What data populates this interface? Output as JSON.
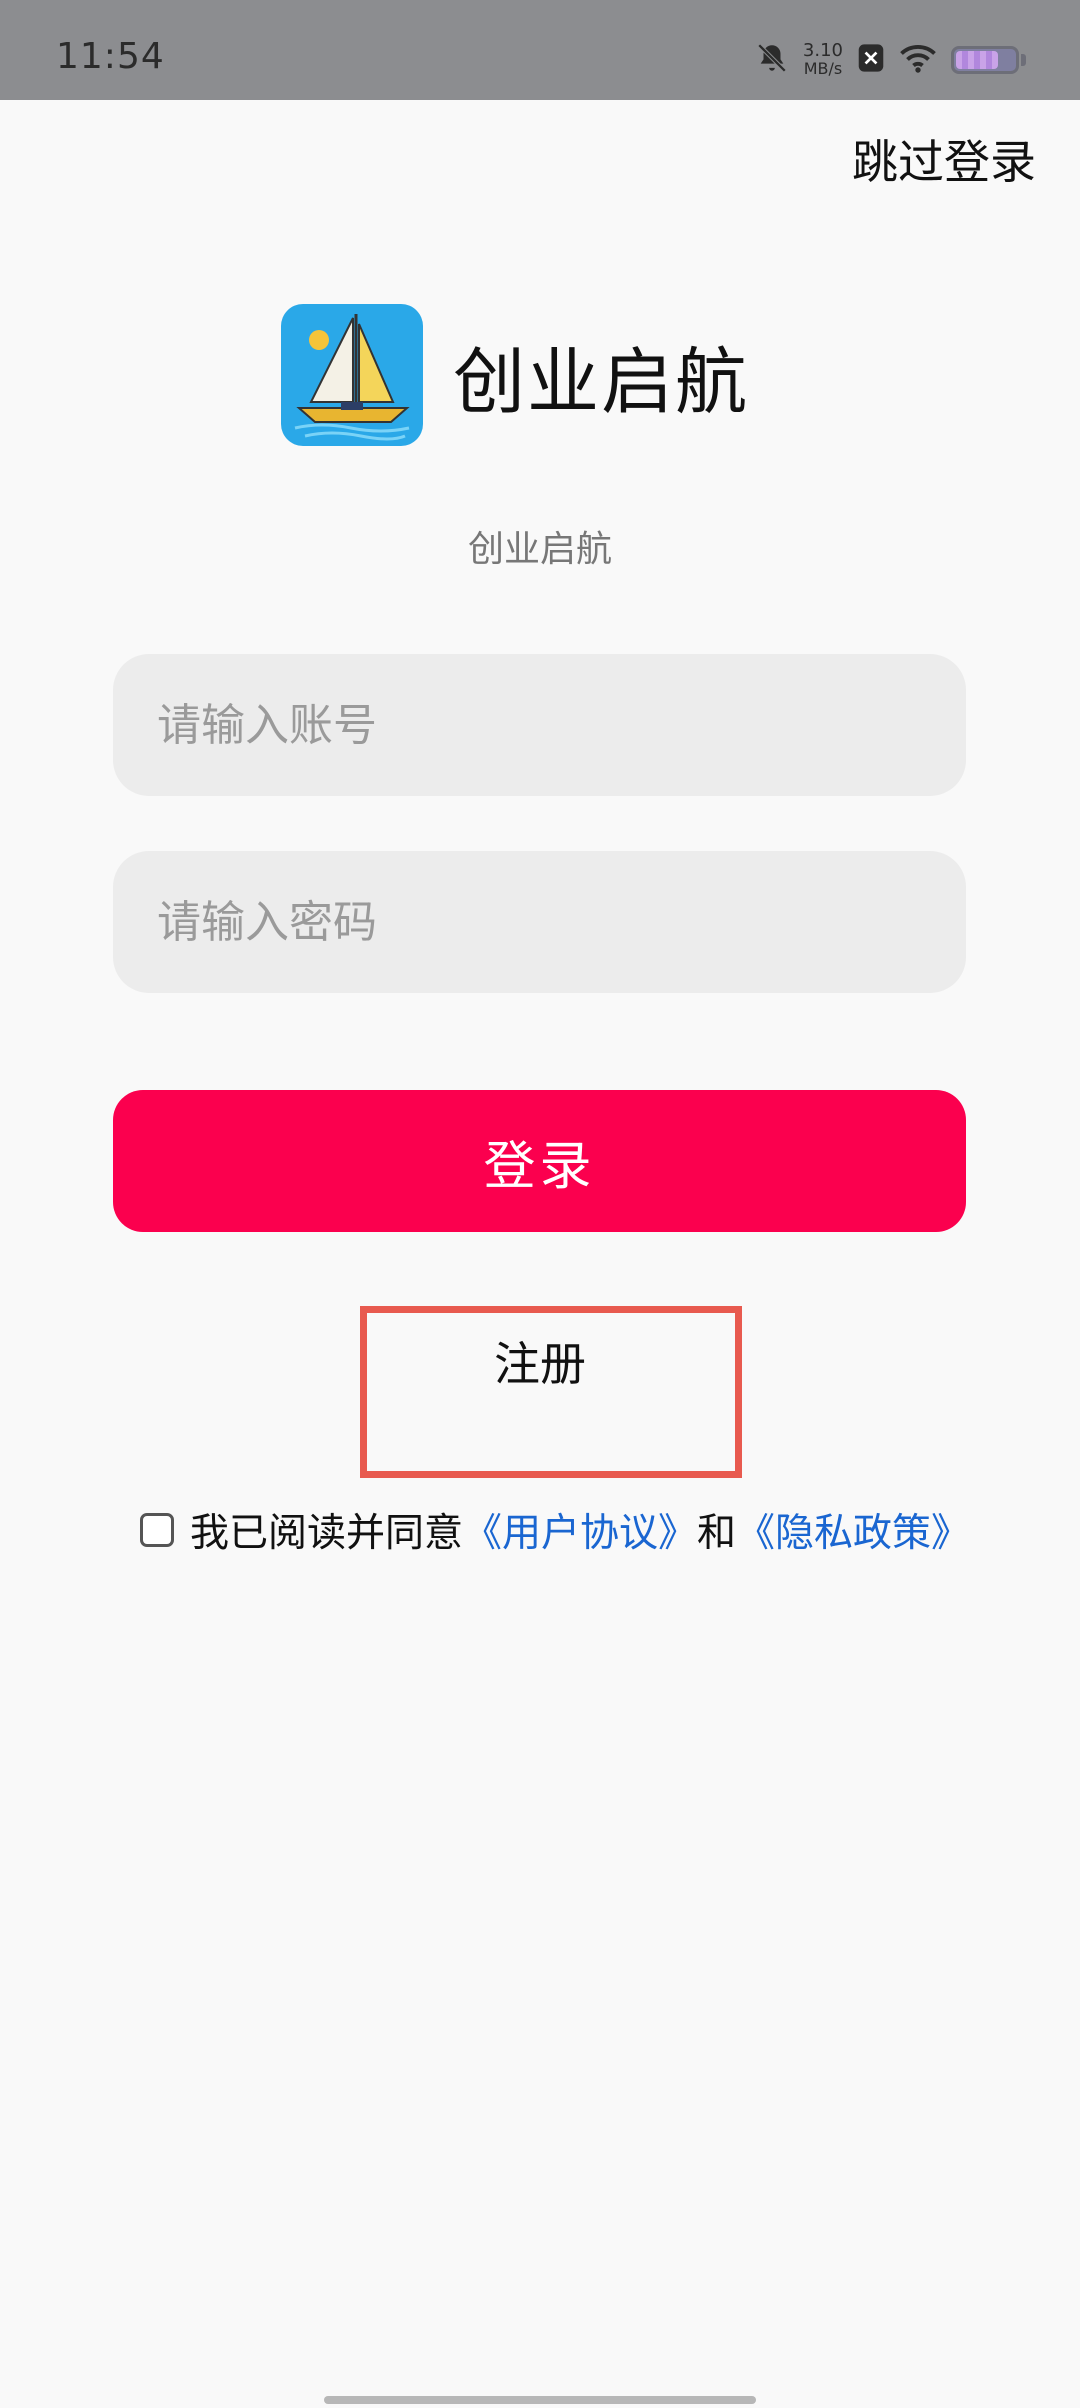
{
  "status_bar": {
    "time": "11:54",
    "net_speed_value": "3.10",
    "net_speed_unit": "MB/s",
    "battery_level": 0.72
  },
  "skip_label": "跳过登录",
  "brand": {
    "name": "创业启航",
    "subtitle": "创业启航"
  },
  "form": {
    "account_placeholder": "请输入账号",
    "password_placeholder": "请输入密码",
    "login_label": "登录",
    "register_label": "注册"
  },
  "agreement": {
    "prefix": "我已阅读并同意",
    "user_agreement": "《用户协议》",
    "and": "和",
    "privacy_policy": "《隐私政策》"
  },
  "colors": {
    "primary": "#fb004e",
    "link": "#1a66d1",
    "highlight": "#e85a4f"
  }
}
